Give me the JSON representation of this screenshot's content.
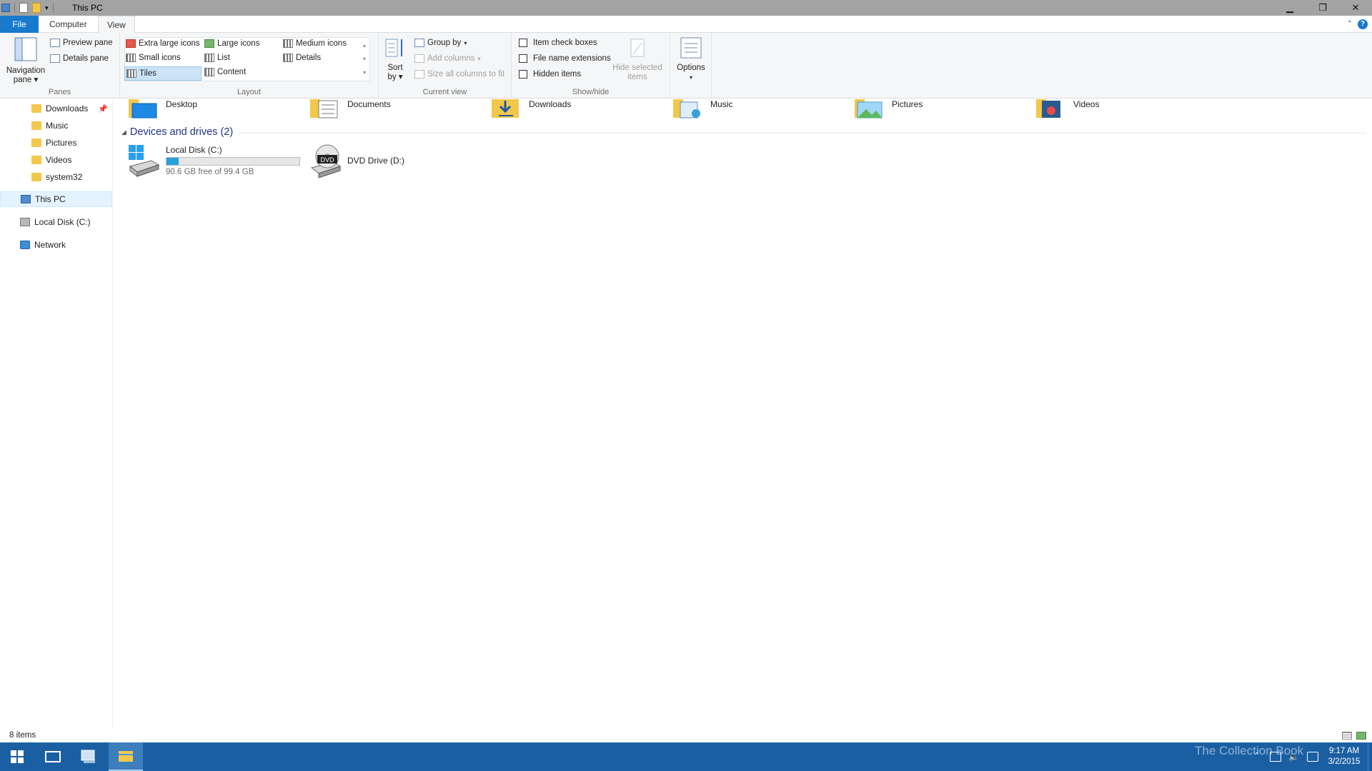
{
  "window": {
    "title": "This PC"
  },
  "ribbon_tabs": {
    "file": "File",
    "computer": "Computer",
    "view": "View"
  },
  "panes": {
    "navigation_pane": "Navigation",
    "navigation_pane_line2": "pane",
    "preview_pane": "Preview pane",
    "details_pane": "Details pane",
    "label": "Panes"
  },
  "layout": {
    "extra_large_icons": "Extra large icons",
    "large_icons": "Large icons",
    "medium_icons": "Medium icons",
    "small_icons": "Small icons",
    "list": "List",
    "details": "Details",
    "tiles": "Tiles",
    "content": "Content",
    "label": "Layout",
    "selected": "Tiles"
  },
  "current_view": {
    "sort_by": "Sort",
    "sort_by_line2": "by",
    "group_by": "Group by",
    "add_columns": "Add columns",
    "size_all_columns": "Size all columns to fit",
    "label": "Current view"
  },
  "show_hide": {
    "item_check_boxes": "Item check boxes",
    "file_name_extensions": "File name extensions",
    "hidden_items": "Hidden items",
    "hide_selected": "Hide selected",
    "hide_selected_line2": "items",
    "label": "Show/hide"
  },
  "options": {
    "label": "Options"
  },
  "nav_items": [
    {
      "label": "Downloads",
      "icon": "downloads-folder-icon",
      "pinned": true
    },
    {
      "label": "Music",
      "icon": "music-folder-icon"
    },
    {
      "label": "Pictures",
      "icon": "pictures-folder-icon"
    },
    {
      "label": "Videos",
      "icon": "videos-folder-icon"
    },
    {
      "label": "system32",
      "icon": "folder-icon"
    },
    {
      "label": "This PC",
      "icon": "computer-icon",
      "selected": true
    },
    {
      "label": "Local Disk (C:)",
      "icon": "drive-icon"
    },
    {
      "label": "Network",
      "icon": "network-icon"
    }
  ],
  "folders": [
    {
      "label": "Desktop",
      "icon": "desktop-folder-icon"
    },
    {
      "label": "Documents",
      "icon": "documents-folder-icon"
    },
    {
      "label": "Downloads",
      "icon": "downloads-folder-icon"
    },
    {
      "label": "Music",
      "icon": "music-folder-icon"
    },
    {
      "label": "Pictures",
      "icon": "pictures-folder-icon"
    },
    {
      "label": "Videos",
      "icon": "videos-folder-icon"
    }
  ],
  "devices": {
    "header": "Devices and drives (2)",
    "drives": [
      {
        "name": "Local Disk (C:)",
        "free": "90.6 GB free of 99.4 GB",
        "used_fraction": 0.089
      },
      {
        "name": "DVD Drive (D:)",
        "badge": "DVD"
      }
    ]
  },
  "status": {
    "item_count": "8 items"
  },
  "taskbar": {
    "time": "9:17 AM",
    "date": "3/2/2015",
    "watermark": "The Collection Book"
  },
  "colors": {
    "accent": "#1979ca",
    "taskbar": "#1b5fa3",
    "folder": "#f3c84a",
    "progress": "#26a0da"
  }
}
